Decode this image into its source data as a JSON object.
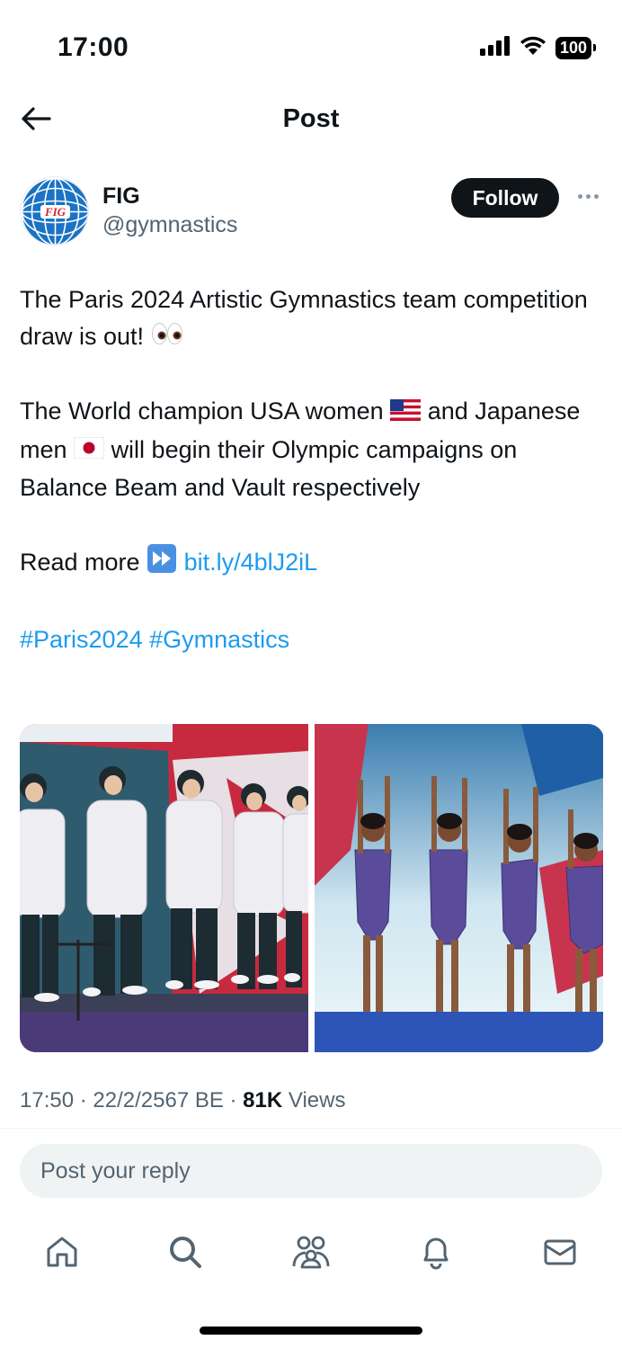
{
  "status_bar": {
    "time": "17:00",
    "battery": "100",
    "icons": [
      "signal-icon",
      "wifi-icon",
      "battery-icon"
    ]
  },
  "header": {
    "title": "Post",
    "back_icon": "arrow-left-icon"
  },
  "author": {
    "name": "FIG",
    "handle": "@gymnastics",
    "avatar_logo_text": "FIG",
    "follow_label": "Follow",
    "more_icon": "more-horizontal-icon"
  },
  "post": {
    "line1": "The Paris 2024 Artistic Gymnastics team competition draw is out!",
    "line2_a": "The World champion USA women",
    "line2_b": "and Japanese men",
    "line2_c": "will begin their Olympic campaigns on Balance Beam and Vault respectively",
    "read_more": "Read more",
    "link": "bit.ly/4blJ2iL",
    "hashtag1": "#Paris2024",
    "hashtag2": "#Gymnastics",
    "emojis": [
      "eyes-emoji",
      "us-flag-emoji",
      "japan-flag-emoji",
      "fast-forward-emoji"
    ]
  },
  "media": [
    {
      "name": "japanese-men-team-photo"
    },
    {
      "name": "usa-women-team-photo"
    }
  ],
  "meta": {
    "time": "17:50",
    "date": "22/2/2567 BE",
    "views_count": "81K",
    "views_label": "Views"
  },
  "reply": {
    "placeholder": "Post your reply"
  },
  "tabs": [
    {
      "icon": "home-icon"
    },
    {
      "icon": "search-icon"
    },
    {
      "icon": "communities-icon"
    },
    {
      "icon": "notifications-icon"
    },
    {
      "icon": "messages-icon"
    }
  ],
  "colors": {
    "link": "#1d9bf0",
    "text": "#0f1419",
    "secondary": "#536471",
    "follow_bg": "#0f1419"
  }
}
